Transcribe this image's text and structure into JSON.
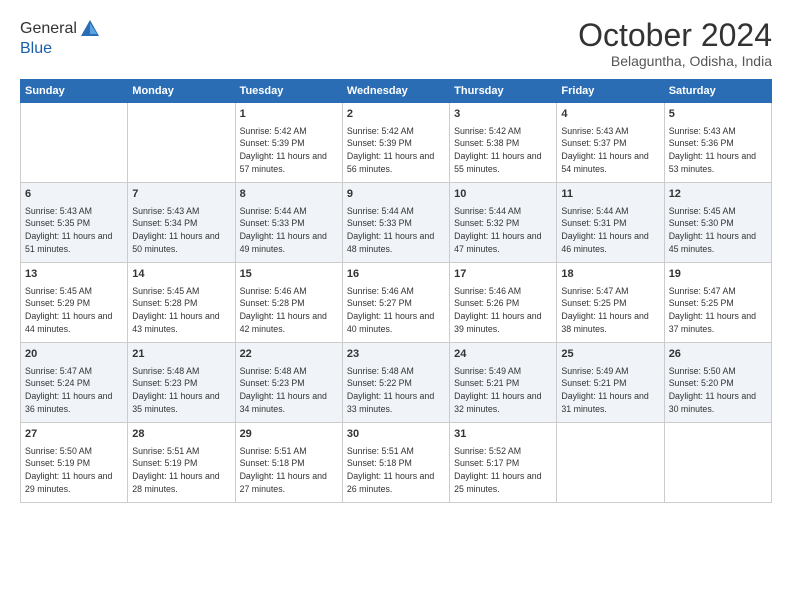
{
  "header": {
    "logo_line1": "General",
    "logo_line2": "Blue",
    "month": "October 2024",
    "location": "Belaguntha, Odisha, India"
  },
  "days": [
    "Sunday",
    "Monday",
    "Tuesday",
    "Wednesday",
    "Thursday",
    "Friday",
    "Saturday"
  ],
  "weeks": [
    [
      {
        "day": "",
        "content": ""
      },
      {
        "day": "",
        "content": ""
      },
      {
        "day": "1",
        "content": "Sunrise: 5:42 AM\nSunset: 5:39 PM\nDaylight: 11 hours and 57 minutes."
      },
      {
        "day": "2",
        "content": "Sunrise: 5:42 AM\nSunset: 5:39 PM\nDaylight: 11 hours and 56 minutes."
      },
      {
        "day": "3",
        "content": "Sunrise: 5:42 AM\nSunset: 5:38 PM\nDaylight: 11 hours and 55 minutes."
      },
      {
        "day": "4",
        "content": "Sunrise: 5:43 AM\nSunset: 5:37 PM\nDaylight: 11 hours and 54 minutes."
      },
      {
        "day": "5",
        "content": "Sunrise: 5:43 AM\nSunset: 5:36 PM\nDaylight: 11 hours and 53 minutes."
      }
    ],
    [
      {
        "day": "6",
        "content": "Sunrise: 5:43 AM\nSunset: 5:35 PM\nDaylight: 11 hours and 51 minutes."
      },
      {
        "day": "7",
        "content": "Sunrise: 5:43 AM\nSunset: 5:34 PM\nDaylight: 11 hours and 50 minutes."
      },
      {
        "day": "8",
        "content": "Sunrise: 5:44 AM\nSunset: 5:33 PM\nDaylight: 11 hours and 49 minutes."
      },
      {
        "day": "9",
        "content": "Sunrise: 5:44 AM\nSunset: 5:33 PM\nDaylight: 11 hours and 48 minutes."
      },
      {
        "day": "10",
        "content": "Sunrise: 5:44 AM\nSunset: 5:32 PM\nDaylight: 11 hours and 47 minutes."
      },
      {
        "day": "11",
        "content": "Sunrise: 5:44 AM\nSunset: 5:31 PM\nDaylight: 11 hours and 46 minutes."
      },
      {
        "day": "12",
        "content": "Sunrise: 5:45 AM\nSunset: 5:30 PM\nDaylight: 11 hours and 45 minutes."
      }
    ],
    [
      {
        "day": "13",
        "content": "Sunrise: 5:45 AM\nSunset: 5:29 PM\nDaylight: 11 hours and 44 minutes."
      },
      {
        "day": "14",
        "content": "Sunrise: 5:45 AM\nSunset: 5:28 PM\nDaylight: 11 hours and 43 minutes."
      },
      {
        "day": "15",
        "content": "Sunrise: 5:46 AM\nSunset: 5:28 PM\nDaylight: 11 hours and 42 minutes."
      },
      {
        "day": "16",
        "content": "Sunrise: 5:46 AM\nSunset: 5:27 PM\nDaylight: 11 hours and 40 minutes."
      },
      {
        "day": "17",
        "content": "Sunrise: 5:46 AM\nSunset: 5:26 PM\nDaylight: 11 hours and 39 minutes."
      },
      {
        "day": "18",
        "content": "Sunrise: 5:47 AM\nSunset: 5:25 PM\nDaylight: 11 hours and 38 minutes."
      },
      {
        "day": "19",
        "content": "Sunrise: 5:47 AM\nSunset: 5:25 PM\nDaylight: 11 hours and 37 minutes."
      }
    ],
    [
      {
        "day": "20",
        "content": "Sunrise: 5:47 AM\nSunset: 5:24 PM\nDaylight: 11 hours and 36 minutes."
      },
      {
        "day": "21",
        "content": "Sunrise: 5:48 AM\nSunset: 5:23 PM\nDaylight: 11 hours and 35 minutes."
      },
      {
        "day": "22",
        "content": "Sunrise: 5:48 AM\nSunset: 5:23 PM\nDaylight: 11 hours and 34 minutes."
      },
      {
        "day": "23",
        "content": "Sunrise: 5:48 AM\nSunset: 5:22 PM\nDaylight: 11 hours and 33 minutes."
      },
      {
        "day": "24",
        "content": "Sunrise: 5:49 AM\nSunset: 5:21 PM\nDaylight: 11 hours and 32 minutes."
      },
      {
        "day": "25",
        "content": "Sunrise: 5:49 AM\nSunset: 5:21 PM\nDaylight: 11 hours and 31 minutes."
      },
      {
        "day": "26",
        "content": "Sunrise: 5:50 AM\nSunset: 5:20 PM\nDaylight: 11 hours and 30 minutes."
      }
    ],
    [
      {
        "day": "27",
        "content": "Sunrise: 5:50 AM\nSunset: 5:19 PM\nDaylight: 11 hours and 29 minutes."
      },
      {
        "day": "28",
        "content": "Sunrise: 5:51 AM\nSunset: 5:19 PM\nDaylight: 11 hours and 28 minutes."
      },
      {
        "day": "29",
        "content": "Sunrise: 5:51 AM\nSunset: 5:18 PM\nDaylight: 11 hours and 27 minutes."
      },
      {
        "day": "30",
        "content": "Sunrise: 5:51 AM\nSunset: 5:18 PM\nDaylight: 11 hours and 26 minutes."
      },
      {
        "day": "31",
        "content": "Sunrise: 5:52 AM\nSunset: 5:17 PM\nDaylight: 11 hours and 25 minutes."
      },
      {
        "day": "",
        "content": ""
      },
      {
        "day": "",
        "content": ""
      }
    ]
  ]
}
